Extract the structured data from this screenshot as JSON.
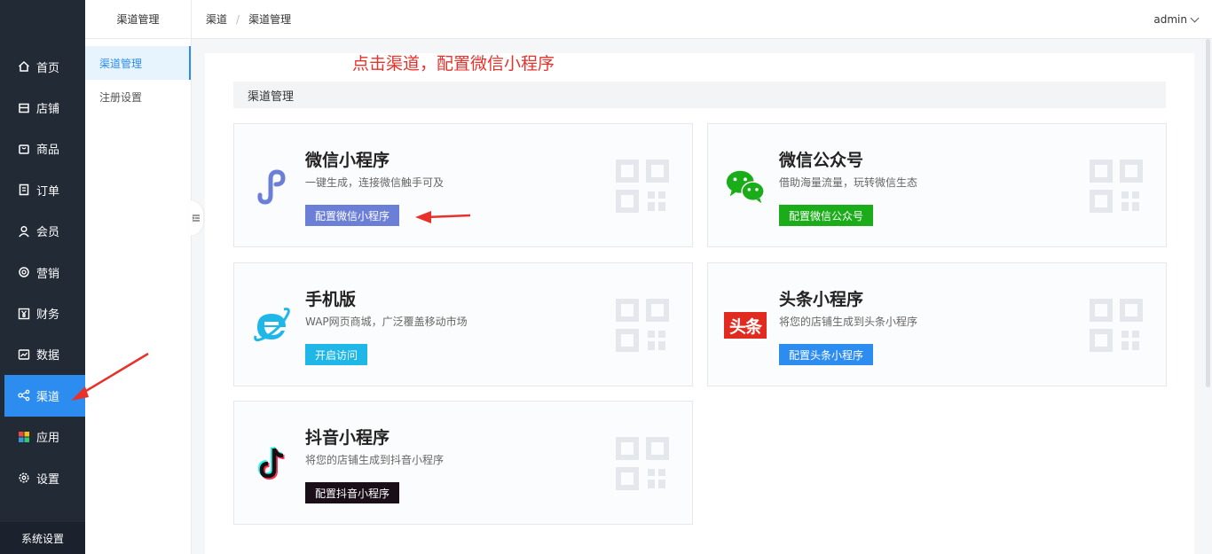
{
  "sidebar": {
    "items": [
      {
        "label": "首页",
        "icon": "home-icon"
      },
      {
        "label": "店铺",
        "icon": "store-icon"
      },
      {
        "label": "商品",
        "icon": "goods-icon"
      },
      {
        "label": "订单",
        "icon": "order-icon"
      },
      {
        "label": "会员",
        "icon": "user-icon"
      },
      {
        "label": "营销",
        "icon": "marketing-icon"
      },
      {
        "label": "财务",
        "icon": "yen-icon"
      },
      {
        "label": "数据",
        "icon": "chart-icon"
      },
      {
        "label": "渠道",
        "icon": "share-icon",
        "active": true
      },
      {
        "label": "应用",
        "icon": "apps-icon"
      },
      {
        "label": "设置",
        "icon": "gear-icon"
      }
    ],
    "footer": "系统设置",
    "active_color": "#2d8cf0"
  },
  "subnav": {
    "header": "渠道管理",
    "items": [
      {
        "label": "渠道管理",
        "active": true
      },
      {
        "label": "注册设置",
        "active": false
      }
    ]
  },
  "breadcrumb": [
    "渠道",
    "渠道管理"
  ],
  "user": {
    "name": "admin"
  },
  "annotation": "点击渠道，配置微信小程序",
  "section": {
    "title": "渠道管理"
  },
  "cards": [
    {
      "title": "微信小程序",
      "desc": "一键生成，连接微信触手可及",
      "button": "配置微信小程序",
      "button_color": "#6b7fd7",
      "icon": "wechat-miniprogram-icon"
    },
    {
      "title": "微信公众号",
      "desc": "借助海量流量，玩转微信生态",
      "button": "配置微信公众号",
      "button_color": "#1aad19",
      "icon": "wechat-icon"
    },
    {
      "title": "手机版",
      "desc": "WAP网页商城，广泛覆盖移动市场",
      "button": "开启访问",
      "button_color": "#1fb6e8",
      "icon": "ie-icon"
    },
    {
      "title": "头条小程序",
      "desc": "将您的店铺生成到头条小程序",
      "button": "配置头条小程序",
      "button_color": "#2d8cf0",
      "icon": "toutiao-icon",
      "icon_text": "头条"
    },
    {
      "title": "抖音小程序",
      "desc": "将您的店铺生成到抖音小程序",
      "button": "配置抖音小程序",
      "button_color": "#1a0f19",
      "icon": "douyin-icon"
    }
  ]
}
